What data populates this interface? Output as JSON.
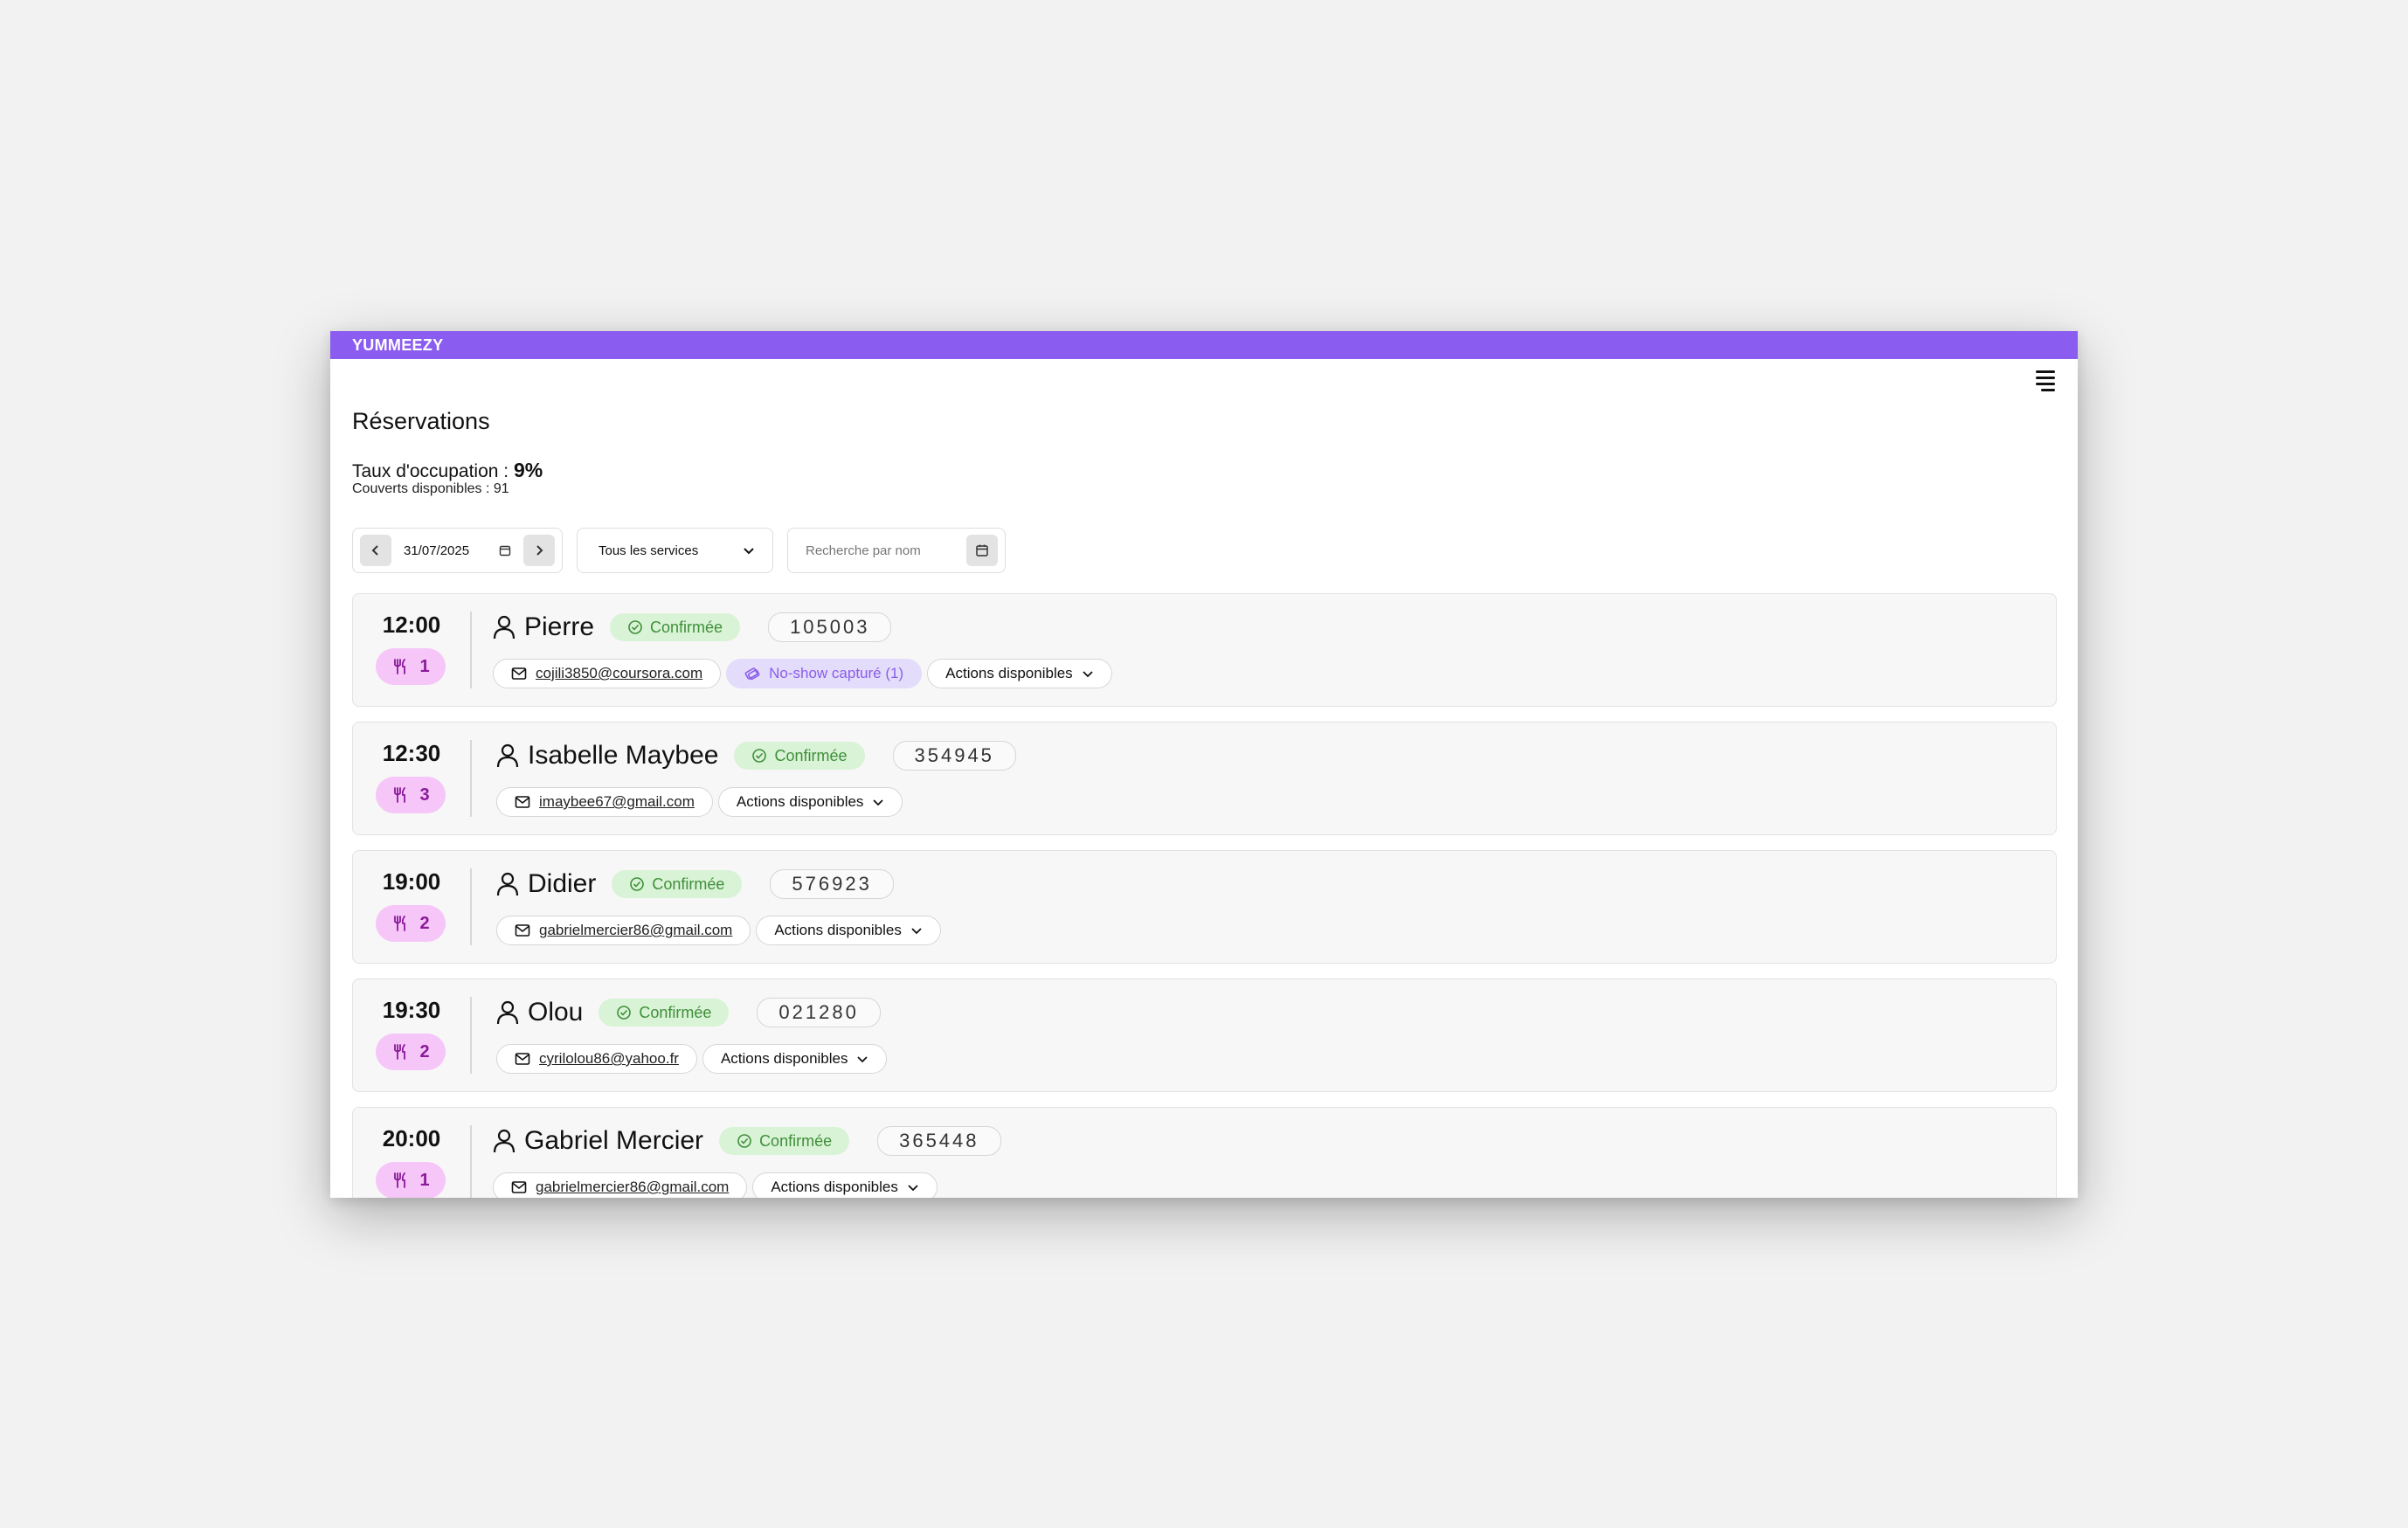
{
  "app": {
    "brand": "YUMMEEZY"
  },
  "page": {
    "title": "Réservations",
    "occupancy_label": "Taux d'occupation :",
    "occupancy_value": "9%",
    "covers_text": "Couverts disponibles : 91"
  },
  "filters": {
    "date": "31/07/2025",
    "service": "Tous les services",
    "search_placeholder": "Recherche par nom"
  },
  "reservations": [
    {
      "time": "12:00",
      "covers": "1",
      "name": "Pierre",
      "status": "Confirmée",
      "code": "105003",
      "email": "cojili3850@coursora.com",
      "noshow": "No-show capturé (1)",
      "actions": "Actions disponibles"
    },
    {
      "time": "12:30",
      "covers": "3",
      "name": "Isabelle Maybee",
      "status": "Confirmée",
      "code": "354945",
      "email": "imaybee67@gmail.com",
      "actions": "Actions disponibles"
    },
    {
      "time": "19:00",
      "covers": "2",
      "name": "Didier",
      "status": "Confirmée",
      "code": "576923",
      "email": "gabrielmercier86@gmail.com",
      "actions": "Actions disponibles"
    },
    {
      "time": "19:30",
      "covers": "2",
      "name": "Olou",
      "status": "Confirmée",
      "code": "021280",
      "email": "cyrilolou86@yahoo.fr",
      "actions": "Actions disponibles"
    },
    {
      "time": "20:00",
      "covers": "1",
      "name": "Gabriel Mercier",
      "status": "Confirmée",
      "code": "365448",
      "email": "gabrielmercier86@gmail.com",
      "actions": "Actions disponibles"
    }
  ],
  "colors": {
    "brand": "#8b5cf0",
    "confirmed_bg": "#d9f3d6",
    "covers_bg": "#f5c6f7",
    "noshow_bg": "#e4dcfb"
  },
  "icons": [
    "menu-icon",
    "chevron-left-icon",
    "chevron-right-icon",
    "calendar-icon",
    "chevron-down-icon",
    "user-icon",
    "check-circle-icon",
    "utensils-icon",
    "mail-icon",
    "credit-card-icon"
  ]
}
